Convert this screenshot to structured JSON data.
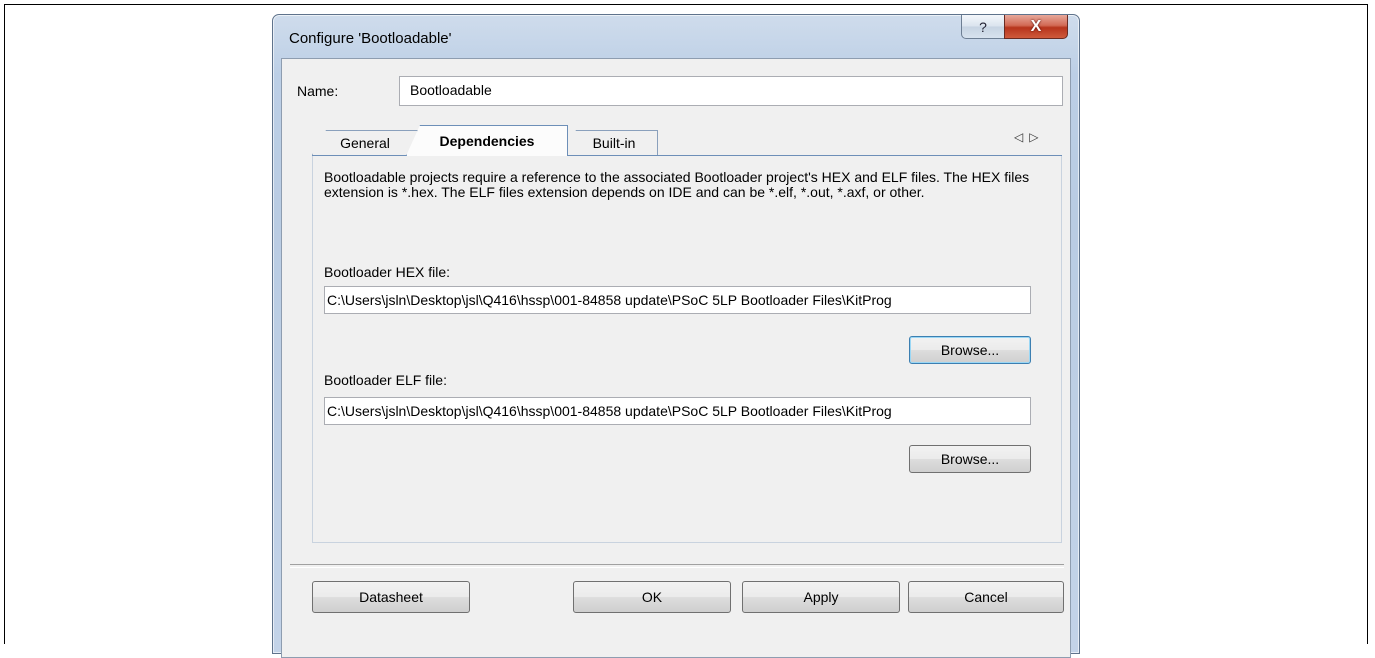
{
  "window": {
    "title": "Configure 'Bootloadable'",
    "help_label": "?",
    "close_label": "X"
  },
  "name_field": {
    "label": "Name:",
    "value": "Bootloadable"
  },
  "tabs": [
    {
      "label": "General",
      "active": false
    },
    {
      "label": "Dependencies",
      "active": true
    },
    {
      "label": "Built-in",
      "active": false
    }
  ],
  "tab_scroll": {
    "left": "◁",
    "right": "▷"
  },
  "dependencies": {
    "description": "Bootloadable projects require a reference to the associated Bootloader project's HEX and ELF files. The HEX files extension is *.hex. The ELF files extension depends on IDE and can be *.elf, *.out, *.axf, or other.",
    "hex_label": "Bootloader HEX file:",
    "hex_path": "C:\\Users\\jsln\\Desktop\\jsl\\Q416\\hssp\\001-84858 update\\PSoC 5LP Bootloader Files\\KitProg",
    "hex_browse": "Browse...",
    "elf_label": "Bootloader ELF file:",
    "elf_path": "C:\\Users\\jsln\\Desktop\\jsl\\Q416\\hssp\\001-84858 update\\PSoC 5LP Bootloader Files\\KitProg",
    "elf_browse": "Browse..."
  },
  "buttons": {
    "datasheet": "Datasheet",
    "ok": "OK",
    "apply": "Apply",
    "cancel": "Cancel"
  }
}
